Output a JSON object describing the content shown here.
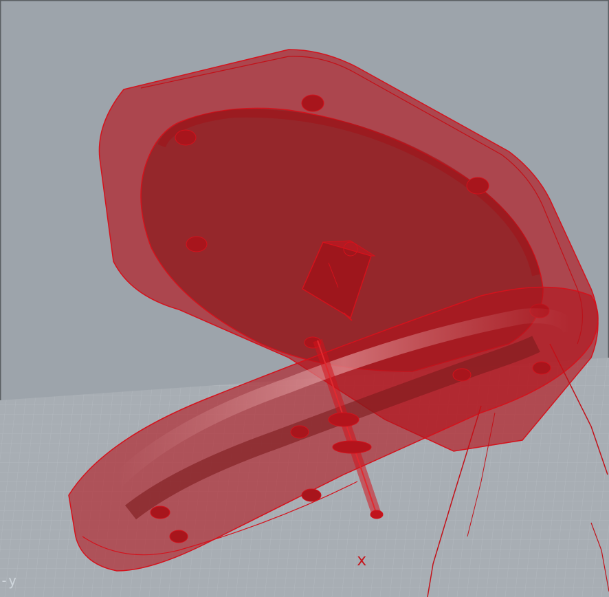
{
  "viewport": {
    "background": "#9da4ab",
    "grid_color": "#aeb5bb",
    "model_color": "#b3141c",
    "model_edge": "#d4121c",
    "frame_color": "#5a5f63"
  },
  "axes": {
    "x_label": "x",
    "y_label": "-y"
  }
}
